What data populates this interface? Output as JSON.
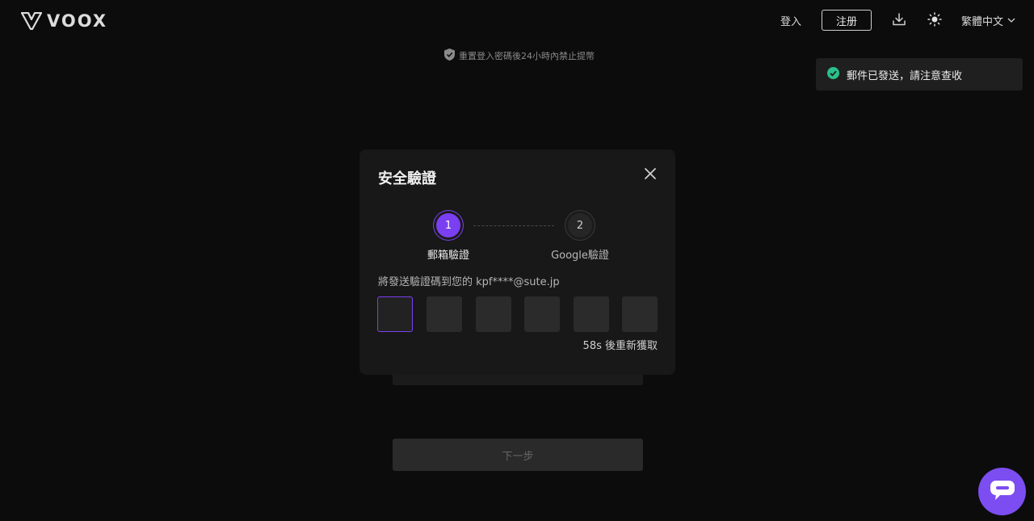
{
  "header": {
    "logo_text": "VOOX",
    "login_label": "登入",
    "register_label": "注册",
    "language_label": "繁體中文",
    "download_icon": "download-icon",
    "theme_icon": "sun-icon"
  },
  "notice": {
    "text": "重置登入密碼後24小時內禁止提幣",
    "icon": "shield-check-icon"
  },
  "toast": {
    "text": "郵件已發送，請注意查收",
    "icon": "check-circle-icon"
  },
  "modal": {
    "title": "安全驗證",
    "steps": [
      {
        "number": "1",
        "label": "郵箱驗證",
        "active": true
      },
      {
        "number": "2",
        "label": "Google驗證",
        "active": false
      }
    ],
    "send_info": "將發送驗證碼到您的 kpf****@sute.jp",
    "code_values": [
      "",
      "",
      "",
      "",
      "",
      ""
    ],
    "resend_text": "58s 後重新獲取"
  },
  "form": {
    "next_label": "下一步"
  },
  "colors": {
    "accent": "#7b3ff2",
    "toast_check": "#2bbf8a",
    "background": "#0c0c0c"
  }
}
